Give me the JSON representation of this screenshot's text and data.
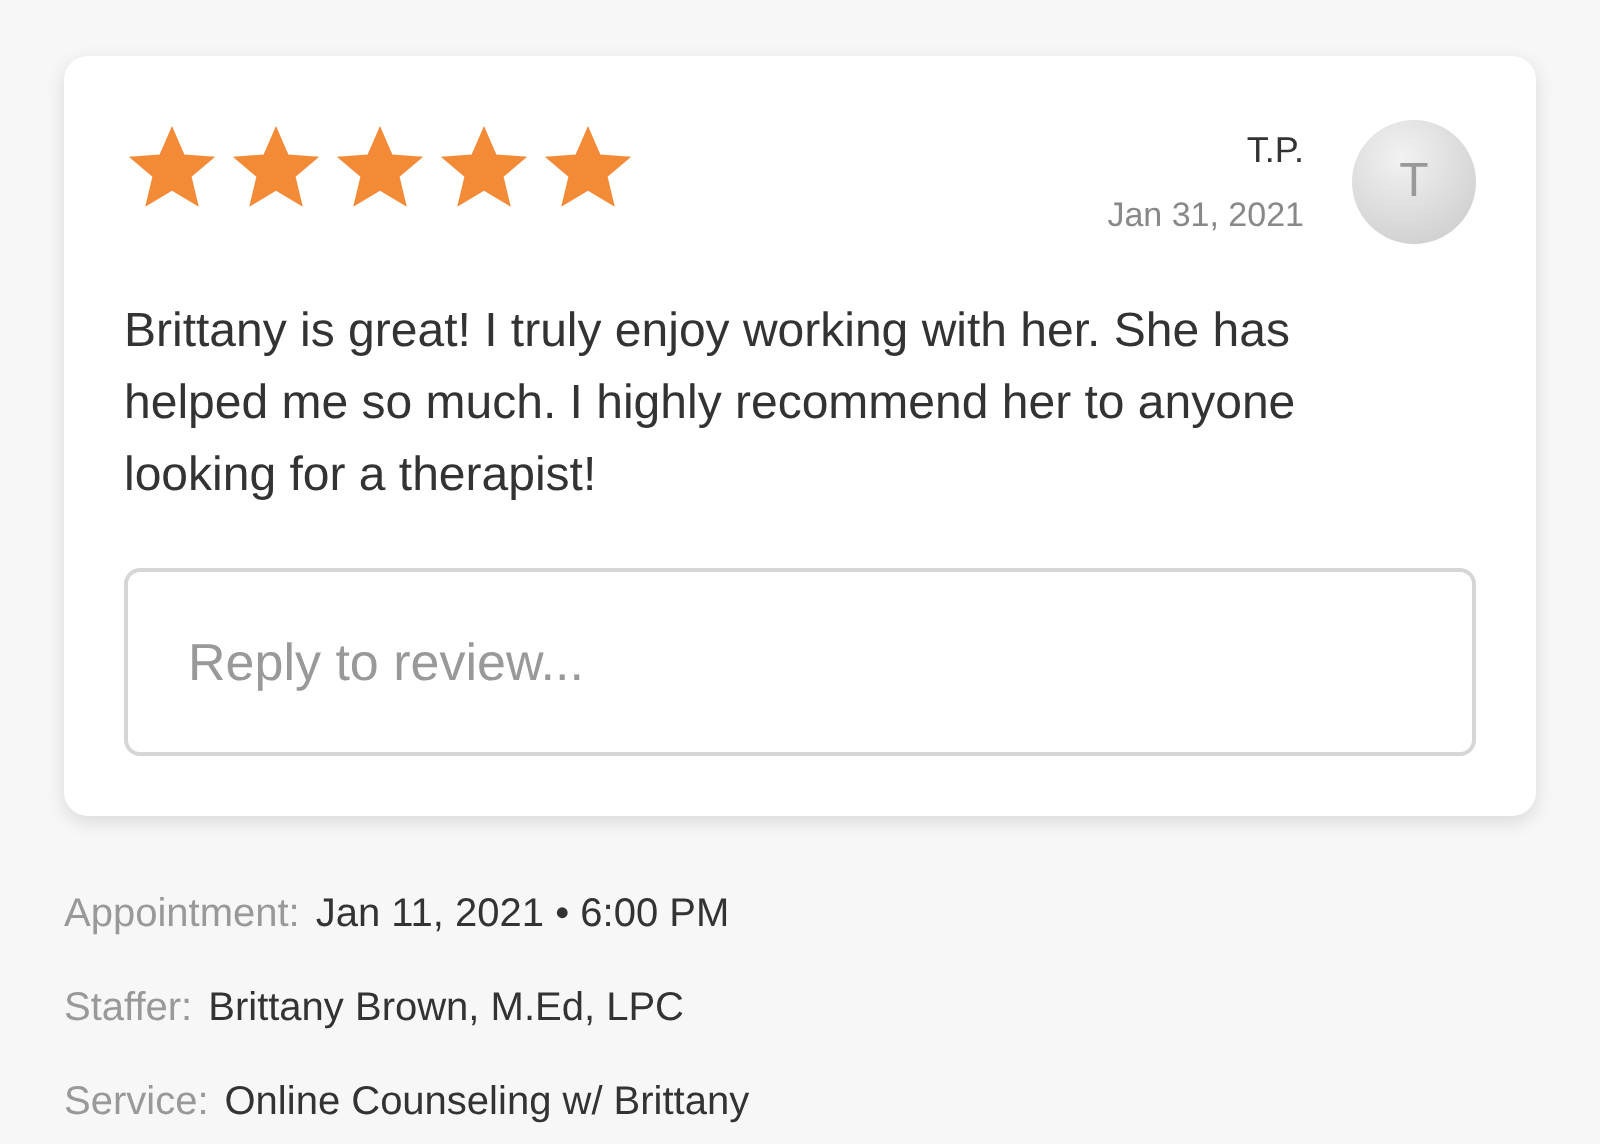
{
  "review": {
    "stars": 5,
    "author": "T.P.",
    "date": "Jan 31, 2021",
    "avatar_letter": "T",
    "text": "Brittany is great! I truly enjoy working with her. She has helped me so much. I highly recommend her to anyone looking for a therapist!",
    "reply": {
      "placeholder": "Reply to review..."
    }
  },
  "details": [
    {
      "label": "Appointment:",
      "value": "Jan 11, 2021 • 6:00 PM"
    },
    {
      "label": "Staffer:",
      "value": "Brittany Brown, M.Ed, LPC"
    },
    {
      "label": "Service:",
      "value": "Online Counseling w/ Brittany"
    }
  ]
}
